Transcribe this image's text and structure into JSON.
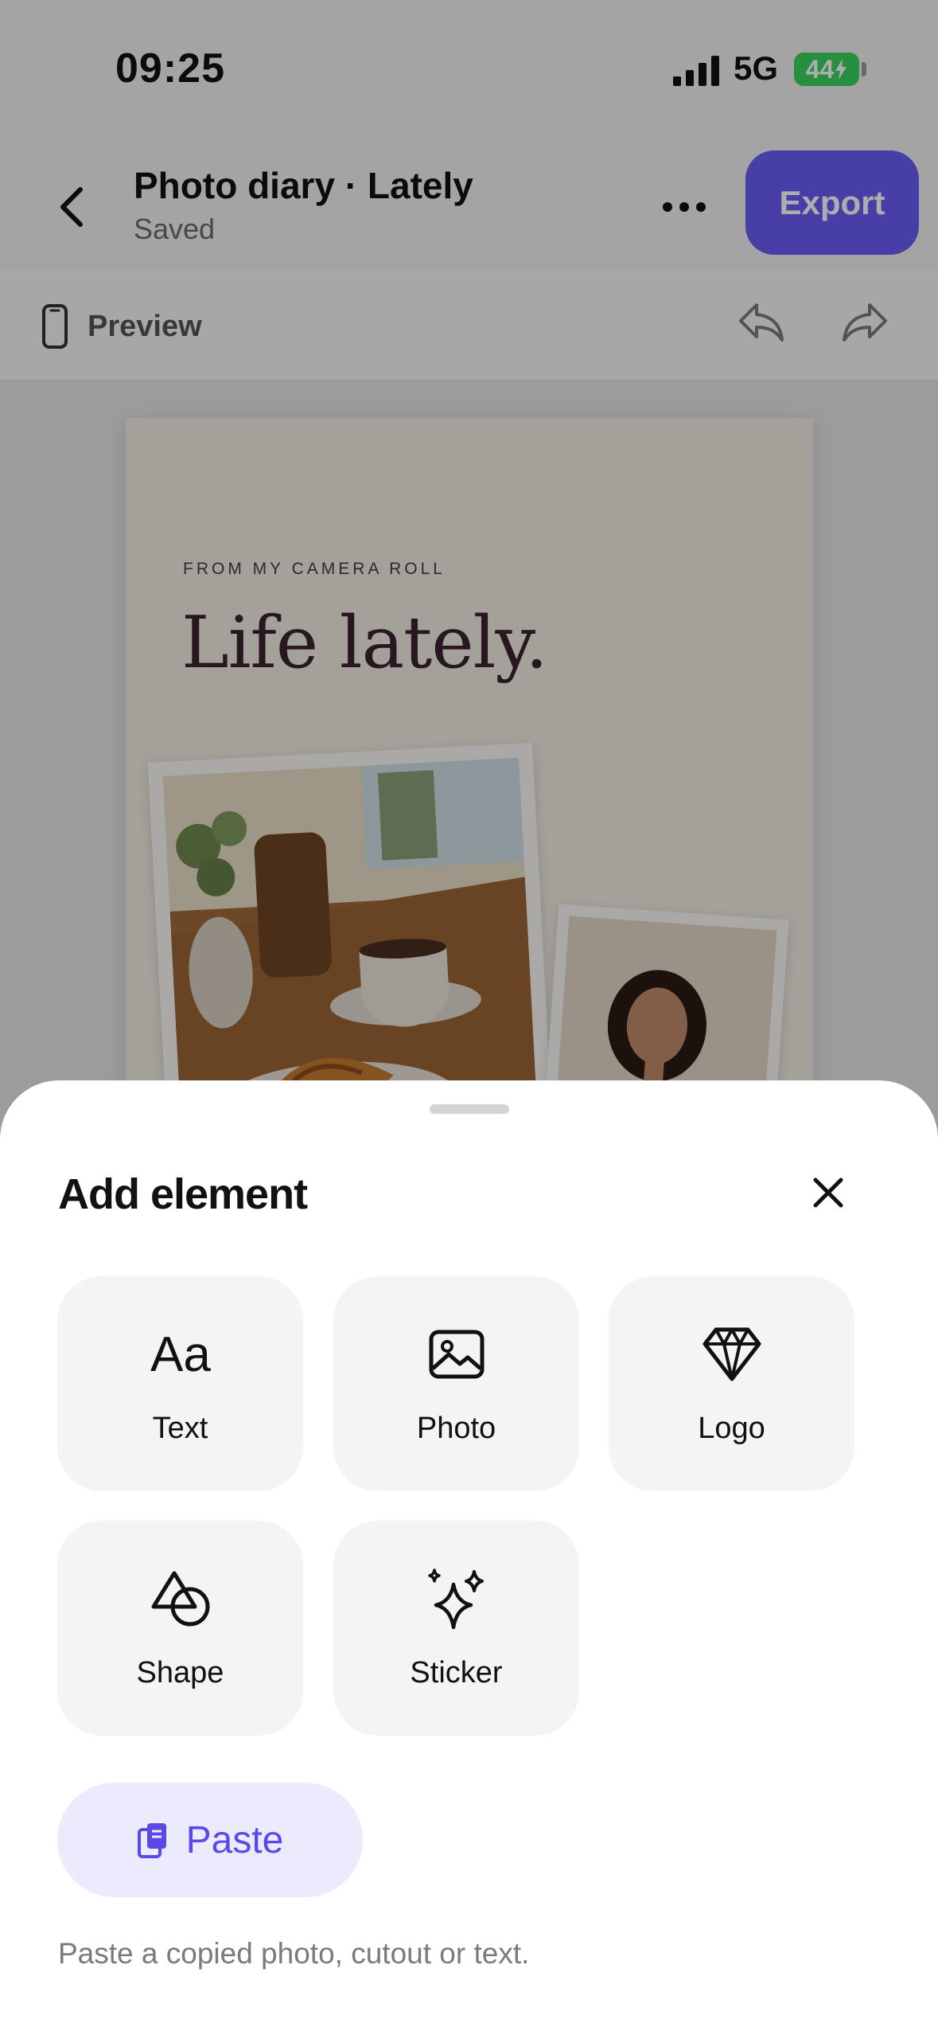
{
  "status_bar": {
    "time": "09:25",
    "network": "5G",
    "battery_level": "44",
    "battery_color": "#3bd35f"
  },
  "top_bar": {
    "title": "Photo diary · Lately",
    "save_status": "Saved",
    "export_label": "Export",
    "accent": "#6a5cf6"
  },
  "sub_bar": {
    "preview_label": "Preview"
  },
  "canvas": {
    "kicker": "FROM MY CAMERA ROLL",
    "headline": "Life lately.",
    "background": "#f2ece3"
  },
  "sheet": {
    "title": "Add element",
    "tiles": [
      {
        "label": "Text",
        "icon": "text-icon"
      },
      {
        "label": "Photo",
        "icon": "image-icon"
      },
      {
        "label": "Logo",
        "icon": "diamond-icon"
      },
      {
        "label": "Shape",
        "icon": "shape-icon"
      },
      {
        "label": "Sticker",
        "icon": "sparkle-icon"
      }
    ],
    "paste_label": "Paste",
    "paste_hint": "Paste a copied photo, cutout or text.",
    "paste_accent": "#5a49e8"
  }
}
